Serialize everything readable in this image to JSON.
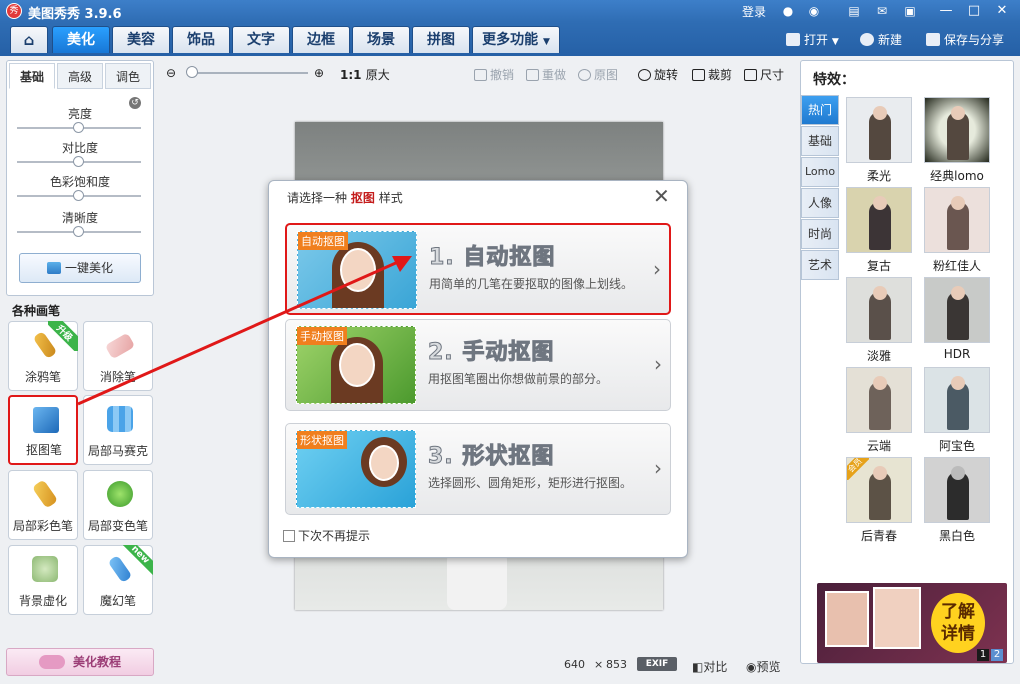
{
  "window": {
    "title": "美图秀秀 3.9.6",
    "login": "登录"
  },
  "tabs": [
    "美化",
    "美容",
    "饰品",
    "文字",
    "边框",
    "场景",
    "拼图",
    "更多功能"
  ],
  "toolbar_right": {
    "open": "打开",
    "new": "新建",
    "save_share": "保存与分享"
  },
  "left_panel": {
    "subtabs": [
      "基础",
      "高级",
      "调色"
    ],
    "sliders": [
      {
        "label": "亮度",
        "value": 0.5
      },
      {
        "label": "对比度",
        "value": 0.5
      },
      {
        "label": "色彩饱和度",
        "value": 0.5
      },
      {
        "label": "清晰度",
        "value": 0.5
      }
    ],
    "one_click": "一键美化",
    "brushes_title": "各种画笔",
    "brushes": [
      {
        "label": "涂鸦笔",
        "badge": "升级"
      },
      {
        "label": "消除笔",
        "badge": ""
      },
      {
        "label": "抠图笔",
        "badge": ""
      },
      {
        "label": "局部马赛克",
        "badge": ""
      },
      {
        "label": "局部彩色笔",
        "badge": ""
      },
      {
        "label": "局部变色笔",
        "badge": ""
      },
      {
        "label": "背景虚化",
        "badge": ""
      },
      {
        "label": "魔幻笔",
        "badge": "new"
      }
    ],
    "tutorial": "美化教程"
  },
  "canvas_toolbar": {
    "ratio": "1:1",
    "original_size": "原大",
    "undo": "撤销",
    "redo": "重做",
    "original": "原图",
    "rotate": "旋转",
    "crop": "裁剪",
    "size": "尺寸"
  },
  "status": {
    "width": "640",
    "x": "×",
    "height": "853",
    "exif": "EXIF",
    "compare": "对比",
    "preview": "预览"
  },
  "dialog": {
    "title_prefix": "请选择一种",
    "title_highlight": "抠图",
    "title_suffix": "样式",
    "options": [
      {
        "tag": "自动抠图",
        "title": "1. 自动抠图",
        "desc": "用简单的几笔在要抠取的图像上划线。"
      },
      {
        "tag": "手动抠图",
        "title": "2. 手动抠图",
        "desc": "用抠图笔圈出你想做前景的部分。"
      },
      {
        "tag": "形状抠图",
        "title": "3. 形状抠图",
        "desc": "选择圆形、圆角矩形，矩形进行抠图。"
      }
    ],
    "dont_show": "下次不再提示"
  },
  "right_panel": {
    "title": "特效：",
    "vtabs": [
      "热门",
      "基础",
      "Lomo",
      "人像",
      "时尚",
      "艺术"
    ],
    "effects": [
      {
        "label": "柔光",
        "badge": ""
      },
      {
        "label": "经典lomo",
        "badge": ""
      },
      {
        "label": "复古",
        "badge": ""
      },
      {
        "label": "粉红佳人",
        "badge": ""
      },
      {
        "label": "淡雅",
        "badge": ""
      },
      {
        "label": "HDR",
        "badge": ""
      },
      {
        "label": "云端",
        "badge": ""
      },
      {
        "label": "阿宝色",
        "badge": ""
      },
      {
        "label": "后青春",
        "badge": "会员"
      },
      {
        "label": "黑白色",
        "badge": ""
      }
    ],
    "ad": {
      "cta_line1": "了解",
      "cta_line2": "详情",
      "pages": [
        "1",
        "2"
      ]
    }
  }
}
